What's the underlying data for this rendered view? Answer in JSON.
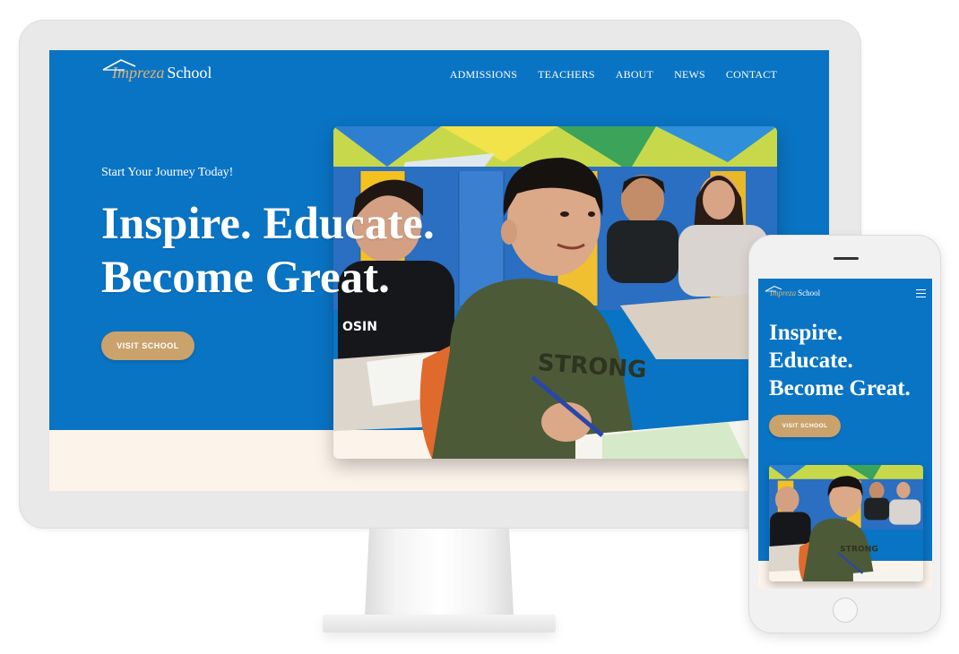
{
  "brand": {
    "name_part1": "Impreza",
    "name_part2": "School"
  },
  "nav": {
    "items": [
      "ADMISSIONS",
      "TEACHERS",
      "ABOUT",
      "NEWS",
      "CONTACT"
    ]
  },
  "hero": {
    "tagline": "Start Your Journey Today!",
    "headline_line1": "Inspire. Educate.",
    "headline_line2": "Become Great.",
    "cta_label": "VISIT SCHOOL"
  },
  "mobile": {
    "headline_line1": "Inspire.",
    "headline_line2": "Educate.",
    "headline_line3": "Become Great.",
    "cta_label": "VISIT SCHOOL"
  },
  "photo": {
    "shirt_text": "STRONG",
    "shirt_text_girl": "OSIN"
  },
  "colors": {
    "primary_blue": "#0a74c4",
    "accent_gold": "#caa26c",
    "cream": "#fcf3ea"
  }
}
